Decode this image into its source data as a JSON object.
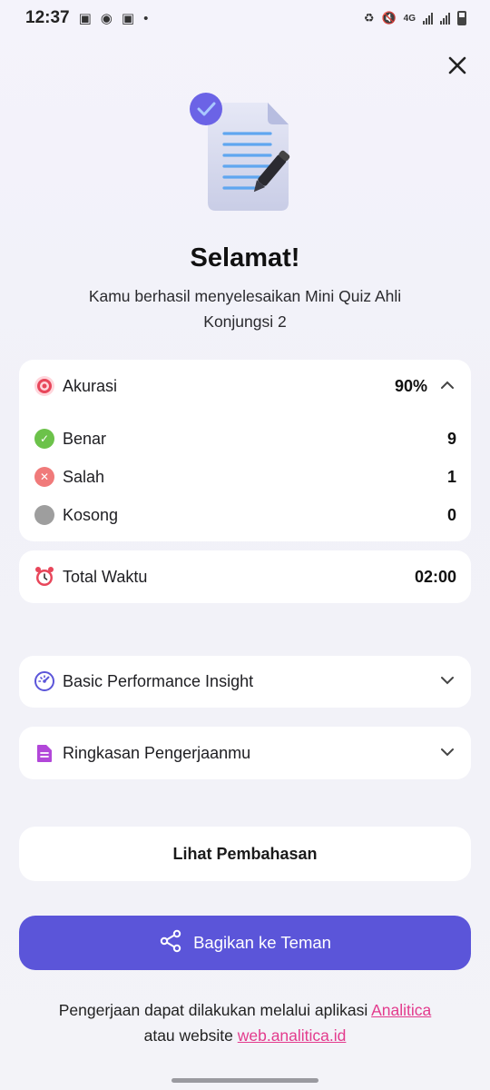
{
  "status_bar": {
    "time": "12:37",
    "network": "4G"
  },
  "header": {
    "close_icon": "close-icon"
  },
  "result": {
    "title": "Selamat!",
    "subtitle": "Kamu berhasil menyelesaikan Mini Quiz  Ahli Konjungsi 2"
  },
  "accuracy_card": {
    "label": "Akurasi",
    "value": "90%",
    "rows": [
      {
        "label": "Benar",
        "value": "9",
        "color": "#6cc24a",
        "icon": "check-icon"
      },
      {
        "label": "Salah",
        "value": "1",
        "color": "#f07a7a",
        "icon": "x-icon"
      },
      {
        "label": "Kosong",
        "value": "0",
        "color": "#9e9e9e",
        "icon": "empty-icon"
      }
    ]
  },
  "time_card": {
    "label": "Total Waktu",
    "value": "02:00"
  },
  "insight_card": {
    "label": "Basic Performance Insight"
  },
  "summary_card": {
    "label": "Ringkasan Pengerjaanmu"
  },
  "actions": {
    "review_label": "Lihat Pembahasan",
    "share_label": "Bagikan ke Teman"
  },
  "footer": {
    "text1": "Pengerjaan dapat dilakukan melalui aplikasi ",
    "app_link": "Analitica",
    "text2": "atau website ",
    "web_link": "web.analitica.id"
  },
  "colors": {
    "primary": "#5b55d9",
    "link": "#e33b8d"
  }
}
